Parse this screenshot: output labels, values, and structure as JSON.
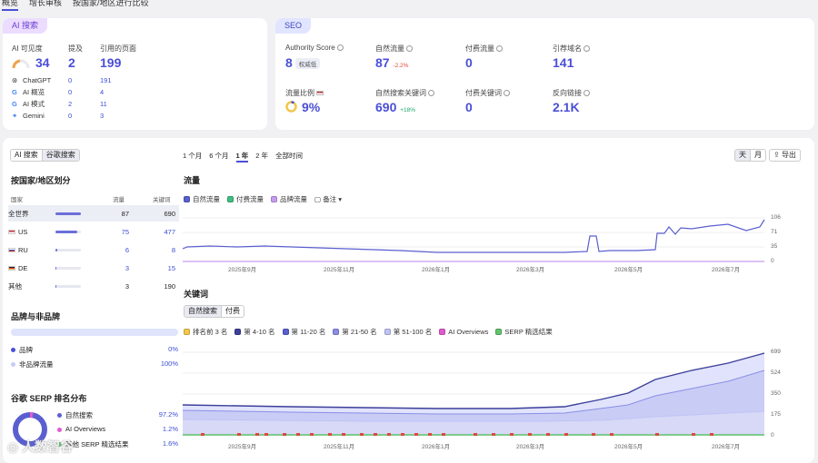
{
  "topnav": {
    "tabs": [
      "概览",
      "增长审核",
      "按国家/地区进行比较"
    ]
  },
  "ai": {
    "tag": "AI 搜索",
    "col1": "AI 可见度",
    "col2": "提及",
    "col3": "引用的页面",
    "vis": "34",
    "mentions": "2",
    "pages": "199",
    "rows": [
      {
        "name": "ChatGPT",
        "m": "0",
        "p": "191"
      },
      {
        "name": "AI 概览",
        "m": "0",
        "p": "4"
      },
      {
        "name": "AI 模式",
        "m": "2",
        "p": "11"
      },
      {
        "name": "Gemini",
        "m": "0",
        "p": "3"
      }
    ]
  },
  "seo": {
    "tag": "SEO",
    "authority": {
      "label": "Authority Score",
      "value": "8",
      "badge": "权威低"
    },
    "organic": {
      "label": "自然流量",
      "value": "87",
      "delta": "-2.2%"
    },
    "paid": {
      "label": "付费流量",
      "value": "0"
    },
    "refdomains": {
      "label": "引荐域名",
      "value": "141"
    },
    "share": {
      "label": "流量比例",
      "value": "9%"
    },
    "orgkw": {
      "label": "自然搜索关键词",
      "value": "690",
      "delta": "+18%"
    },
    "paidkw": {
      "label": "付费关键词",
      "value": "0"
    },
    "backlinks": {
      "label": "反向链接",
      "value": "2.1K"
    }
  },
  "left": {
    "tabs": [
      "AI 搜索",
      "谷歌搜索"
    ],
    "country_title": "按国家/地区划分",
    "col_country": "国家",
    "col_traffic": "流量",
    "col_kw": "关键词",
    "countries": [
      {
        "name": "全世界",
        "traffic": "87",
        "kw": "690",
        "fill": 1.0
      },
      {
        "name": "US",
        "traffic": "75",
        "kw": "477",
        "fill": 0.86
      },
      {
        "name": "RU",
        "traffic": "6",
        "kw": "8",
        "fill": 0.07
      },
      {
        "name": "DE",
        "traffic": "3",
        "kw": "15",
        "fill": 0.04
      },
      {
        "name": "其他",
        "traffic": "3",
        "kw": "190",
        "fill": 0.04
      }
    ],
    "brand_title": "品牌与非品牌",
    "brand": "品牌",
    "brand_pct": "0%",
    "nonbrand": "非品牌流量",
    "nonbrand_pct": "100%",
    "serp_title": "谷歌 SERP 排名分布",
    "serp": [
      {
        "name": "自然搜索",
        "pct": "97.2%"
      },
      {
        "name": "AI Overviews",
        "pct": "1.2%"
      },
      {
        "name": "其他 SERP 精选结果",
        "pct": "1.6%"
      }
    ]
  },
  "range": {
    "tabs": [
      "1 个月",
      "6 个月",
      "1 年",
      "2 年",
      "全部时间"
    ],
    "active": "1 年"
  },
  "view": {
    "day": "天",
    "month": "月",
    "export": "导出"
  },
  "traffic_chart": {
    "title": "流量",
    "legend": [
      "自然流量",
      "付费流量",
      "品牌流量"
    ],
    "notes": "备注",
    "yticks": [
      "106",
      "71",
      "35",
      "0"
    ],
    "xticks": [
      "2025年9月",
      "2025年11月",
      "2026年1月",
      "2026年3月",
      "2026年5月",
      "2026年7月"
    ],
    "colors": {
      "organic": "#5a5fd0",
      "paid": "#3fbf7f",
      "brand": "#c79cf0"
    }
  },
  "kw_chart": {
    "title": "关键词",
    "tabs": [
      "自然搜索",
      "付费"
    ],
    "legend": [
      "排名前 3 名",
      "第 4-10 名",
      "第 11-20 名",
      "第 21-50 名",
      "第 51-100 名",
      "AI Overviews",
      "SERP 精选结果"
    ],
    "legend_colors": [
      "#f4c84a",
      "#3c3f9a",
      "#5a5fd0",
      "#8a8ee6",
      "#bfc3f5",
      "#e25ad1",
      "#62c46b"
    ],
    "yticks": [
      "699",
      "524",
      "350",
      "175",
      "0"
    ],
    "xticks": [
      "2025年9月",
      "2025年11月",
      "2026年1月",
      "2026年3月",
      "2026年5月",
      "2026年7月"
    ]
  },
  "watermark": "人数智谷"
}
